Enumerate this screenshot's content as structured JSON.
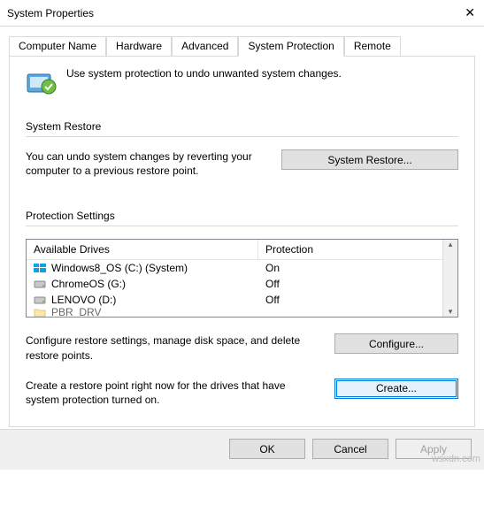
{
  "window": {
    "title": "System Properties"
  },
  "tabs": {
    "t0": "Computer Name",
    "t1": "Hardware",
    "t2": "Advanced",
    "t3": "System Protection",
    "t4": "Remote"
  },
  "intro": "Use system protection to undo unwanted system changes.",
  "restore": {
    "header": "System Restore",
    "text": "You can undo system changes by reverting your computer to a previous restore point.",
    "button": "System Restore..."
  },
  "protection": {
    "header": "Protection Settings",
    "col1": "Available Drives",
    "col2": "Protection",
    "drives": [
      {
        "name": "Windows8_OS (C:) (System)",
        "status": "On",
        "type": "win"
      },
      {
        "name": "ChromeOS (G:)",
        "status": "Off",
        "type": "hdd"
      },
      {
        "name": "LENOVO (D:)",
        "status": "Off",
        "type": "hdd"
      },
      {
        "name": "PBR_DRV",
        "status": "",
        "type": "folder"
      }
    ],
    "configure_text": "Configure restore settings, manage disk space, and delete restore points.",
    "configure_btn": "Configure...",
    "create_text": "Create a restore point right now for the drives that have system protection turned on.",
    "create_btn": "Create..."
  },
  "footer": {
    "ok": "OK",
    "cancel": "Cancel",
    "apply": "Apply"
  },
  "watermark": "wsxdn.com"
}
